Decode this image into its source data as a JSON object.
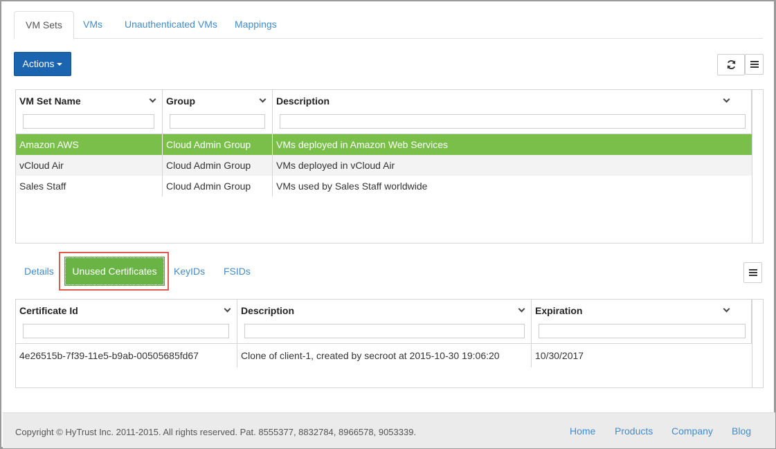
{
  "top_tabs": [
    {
      "label": "VM Sets",
      "active": true
    },
    {
      "label": "VMs"
    },
    {
      "label": "Unauthenticated VMs"
    },
    {
      "label": "Mappings"
    }
  ],
  "toolbar": {
    "actions_label": "Actions",
    "refresh_icon": "refresh-icon",
    "menu_icon": "hamburger-menu-icon"
  },
  "vm_sets_table": {
    "columns": [
      "VM Set Name",
      "Group",
      "Description"
    ],
    "rows": [
      {
        "name": "Amazon AWS",
        "group": "Cloud Admin Group",
        "description": "VMs deployed in Amazon Web Services",
        "selected": true
      },
      {
        "name": "vCloud Air",
        "group": "Cloud Admin Group",
        "description": "VMs deployed in vCloud Air"
      },
      {
        "name": "Sales Staff",
        "group": "Cloud Admin Group",
        "description": "VMs used by Sales Staff worldwide"
      }
    ]
  },
  "sub_tabs": [
    {
      "label": "Details"
    },
    {
      "label": "Unused Certificates",
      "active": true
    },
    {
      "label": "KeyIDs"
    },
    {
      "label": "FSIDs"
    }
  ],
  "certificates_table": {
    "columns": [
      "Certificate Id",
      "Description",
      "Expiration"
    ],
    "rows": [
      {
        "id": "4e26515b-7f39-11e5-b9ab-00505685fd67",
        "description": "Clone of client-1, created by secroot at 2015-10-30 19:06:20",
        "expiration": "10/30/2017"
      }
    ]
  },
  "footer": {
    "copyright": "Copyright © HyTrust Inc. 2011-2015. All rights reserved. Pat. 8555377, 8832784, 8966578, 9053339.",
    "links": [
      "Home",
      "Products",
      "Company",
      "Blog"
    ]
  },
  "colors": {
    "accent": "#428bca",
    "actions_button": "#1b65b0",
    "selected_row": "#79bf4a",
    "active_subtab": "#6ab446",
    "highlight": "#e05a4f"
  }
}
